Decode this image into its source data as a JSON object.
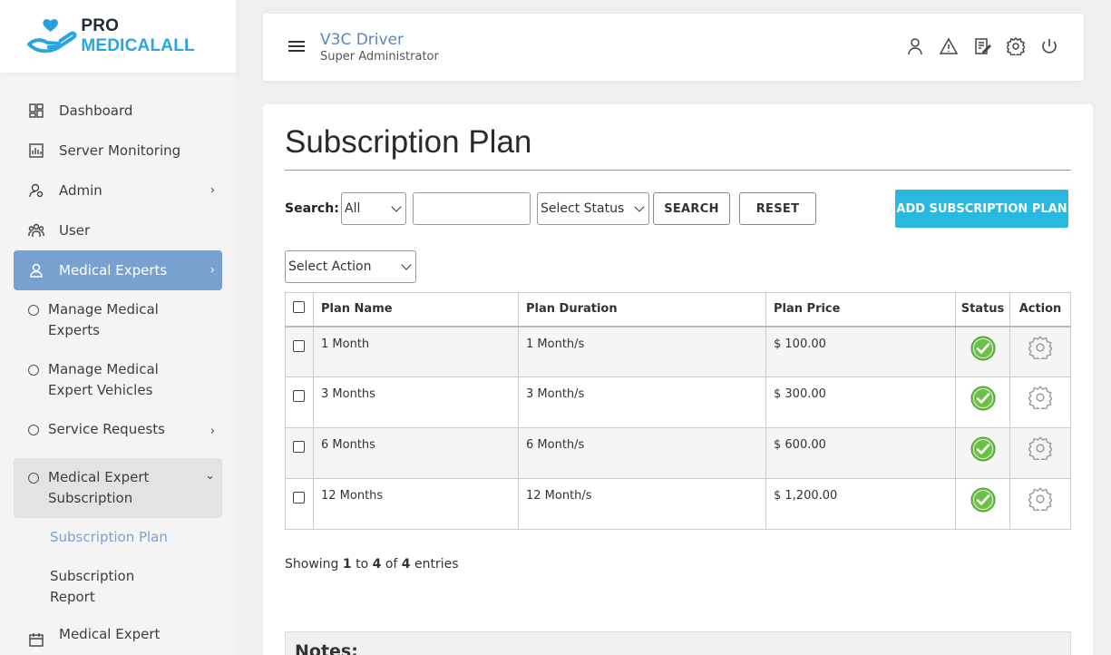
{
  "brand": {
    "pro": "PRO",
    "medical": "MEDICALALL"
  },
  "header": {
    "user_name": "V3C Driver",
    "user_role": "Super Administrator"
  },
  "sidebar": {
    "items": [
      {
        "label": "Dashboard",
        "icon": "dashboard-icon"
      },
      {
        "label": "Server Monitoring",
        "icon": "chart-icon"
      },
      {
        "label": "Admin",
        "icon": "admin-icon",
        "chevron": "›"
      },
      {
        "label": "User",
        "icon": "users-icon"
      },
      {
        "label": "Medical Experts",
        "icon": "user-icon",
        "chevron": "›"
      }
    ],
    "sub_items": {
      "manage_experts": [
        "Manage Medical",
        "Experts"
      ],
      "manage_vehicles": [
        "Manage Medical",
        "Expert Vehicles"
      ],
      "service_requests": "Service Requests",
      "subscription": [
        "Medical Expert",
        "Subscription"
      ],
      "subscription_plan": "Subscription Plan",
      "subscription_report": [
        "Subscription",
        "Report"
      ],
      "medical_expert_next": "Medical Expert"
    }
  },
  "page": {
    "title": "Subscription Plan",
    "search_label": "Search:",
    "filter_all": "All",
    "filter_status": "Select Status",
    "search_button": "SEARCH",
    "reset_button": "RESET",
    "add_button": "ADD SUBSCRIPTION PLAN",
    "action_select": "Select Action"
  },
  "table": {
    "headers": [
      "Plan Name",
      "Plan Duration",
      "Plan Price",
      "Status",
      "Action"
    ],
    "rows": [
      {
        "name": "1 Month",
        "duration": "1 Month/s",
        "price": "$ 100.00"
      },
      {
        "name": "3 Months",
        "duration": "3 Month/s",
        "price": "$ 300.00"
      },
      {
        "name": "6 Months",
        "duration": "6 Month/s",
        "price": "$ 600.00"
      },
      {
        "name": "12 Months",
        "duration": "12 Month/s",
        "price": "$ 1,200.00"
      }
    ]
  },
  "showing": {
    "prefix": "Showing",
    "from": "1",
    "to_word": "to",
    "to": "4",
    "of_word": "of",
    "total": "4",
    "suffix": "entries"
  },
  "notes_label": "Notes:",
  "colors": {
    "accent": "#29b8e0",
    "active_nav": "#79a1d0",
    "status_ok": "#6cc04a"
  }
}
